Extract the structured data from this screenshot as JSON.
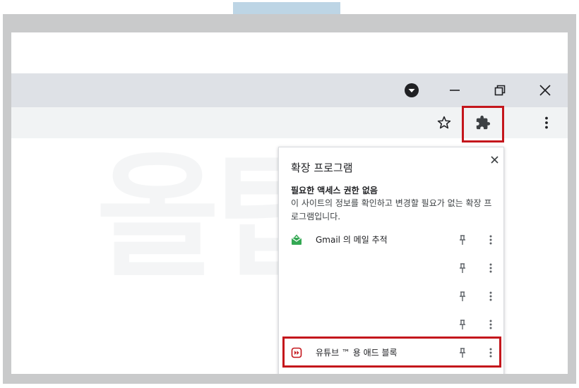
{
  "window": {
    "controls": [
      "dropdown",
      "minimize",
      "restore",
      "close"
    ]
  },
  "toolbar": {
    "icons": [
      "star-icon",
      "puzzle-icon",
      "kebab-menu-icon"
    ]
  },
  "watermark": {
    "text": "올팁스"
  },
  "extensions_panel": {
    "title": "확장 프로그램",
    "permission_heading": "필요한 액세스 권한 없음",
    "permission_desc": "이 사이트의 정보를 확인하고 변경할 필요가 없는 확장 프로그램입니다.",
    "items": [
      {
        "name": "Gmail 의 메일 추적",
        "icon": "gmail-tracker-icon",
        "color": "#34a853"
      },
      {
        "name": "",
        "icon": ""
      },
      {
        "name": "",
        "icon": ""
      },
      {
        "name": "",
        "icon": ""
      },
      {
        "name": "유튜브 ™ 용 애드 블록",
        "icon": "youtube-adblock-icon",
        "color": "#c4161c"
      }
    ]
  },
  "colors": {
    "highlight": "#c4161c",
    "titlebar": "#dee1e6",
    "toolbar": "#f1f3f4"
  }
}
